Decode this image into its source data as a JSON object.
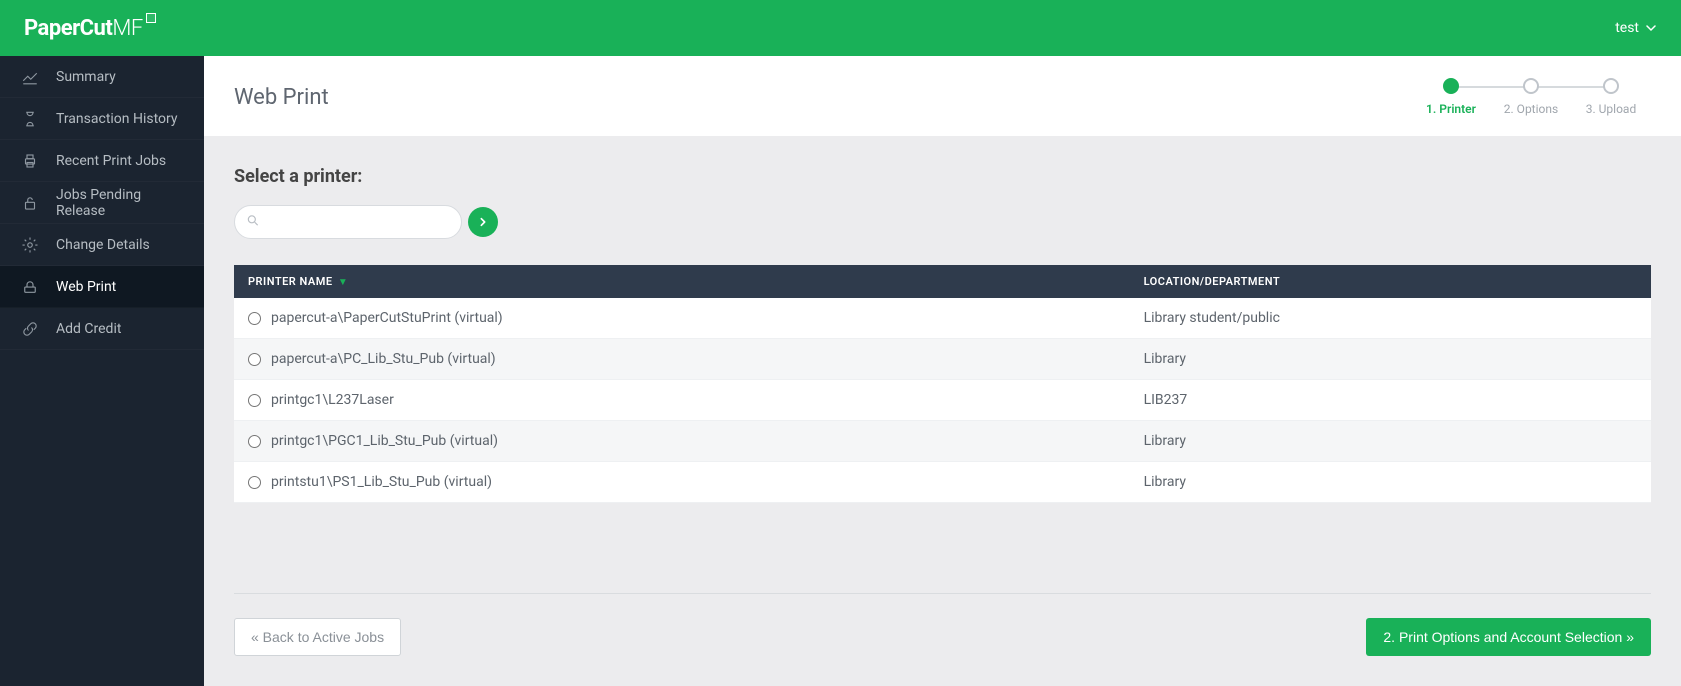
{
  "header": {
    "brand_bold": "PaperCut",
    "brand_thin": "MF",
    "user_label": "test"
  },
  "sidebar": {
    "items": [
      {
        "label": "Summary"
      },
      {
        "label": "Transaction History"
      },
      {
        "label": "Recent Print Jobs"
      },
      {
        "label": "Jobs Pending Release"
      },
      {
        "label": "Change Details"
      },
      {
        "label": "Web Print"
      },
      {
        "label": "Add Credit"
      }
    ]
  },
  "page": {
    "title": "Web Print",
    "steps": [
      {
        "label": "1. Printer"
      },
      {
        "label": "2. Options"
      },
      {
        "label": "3. Upload"
      }
    ]
  },
  "section_title": "Select a printer:",
  "search": {
    "placeholder": ""
  },
  "table": {
    "headers": {
      "printer": "PRINTER NAME",
      "location": "LOCATION/DEPARTMENT"
    },
    "rows": [
      {
        "printer": "papercut-a\\PaperCutStuPrint (virtual)",
        "location": "Library student/public"
      },
      {
        "printer": "papercut-a\\PC_Lib_Stu_Pub (virtual)",
        "location": "Library"
      },
      {
        "printer": "printgc1\\L237Laser",
        "location": "LIB237"
      },
      {
        "printer": "printgc1\\PGC1_Lib_Stu_Pub (virtual)",
        "location": "Library"
      },
      {
        "printer": "printstu1\\PS1_Lib_Stu_Pub (virtual)",
        "location": "Library"
      }
    ]
  },
  "buttons": {
    "back": "« Back to Active Jobs",
    "next": "2. Print Options and Account Selection »"
  }
}
